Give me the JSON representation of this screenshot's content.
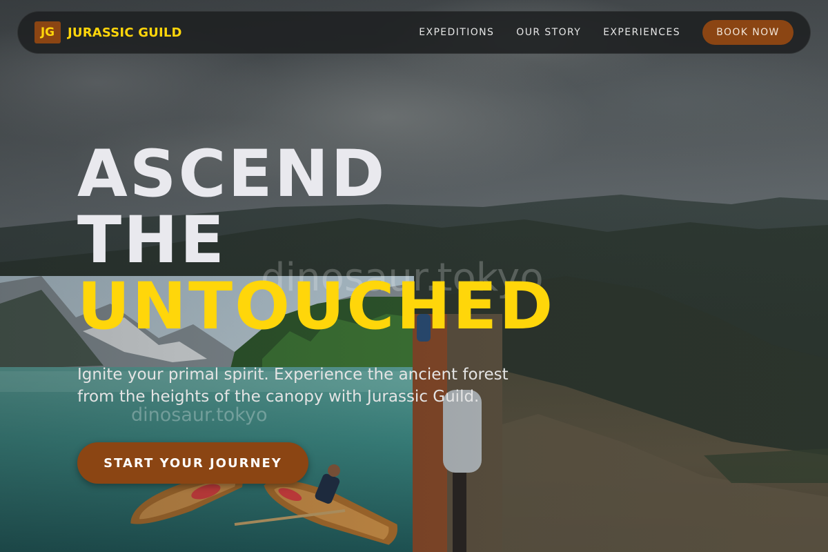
{
  "brand": {
    "logo_text": "JG",
    "name": "JURASSIC GUILD"
  },
  "nav": {
    "links": [
      "EXPEDITIONS",
      "OUR STORY",
      "EXPERIENCES"
    ],
    "book_label": "BOOK NOW"
  },
  "hero": {
    "title_lines": [
      "ASCEND",
      "THE",
      "UNTOUCHED"
    ],
    "subtitle": "Ignite your primal spirit. Experience the ancient forest from the heights of the canopy with Jurassic Guild.",
    "cta_label": "START YOUR JOURNEY"
  },
  "watermarks": [
    "dinosaur.tokyo",
    "dinosaur.tokyo"
  ],
  "colors": {
    "accent_yellow": "#ffd60a",
    "brand_brown": "#8b4513",
    "nav_bg": "#1e2021",
    "title_white": "#e9e9ee"
  }
}
